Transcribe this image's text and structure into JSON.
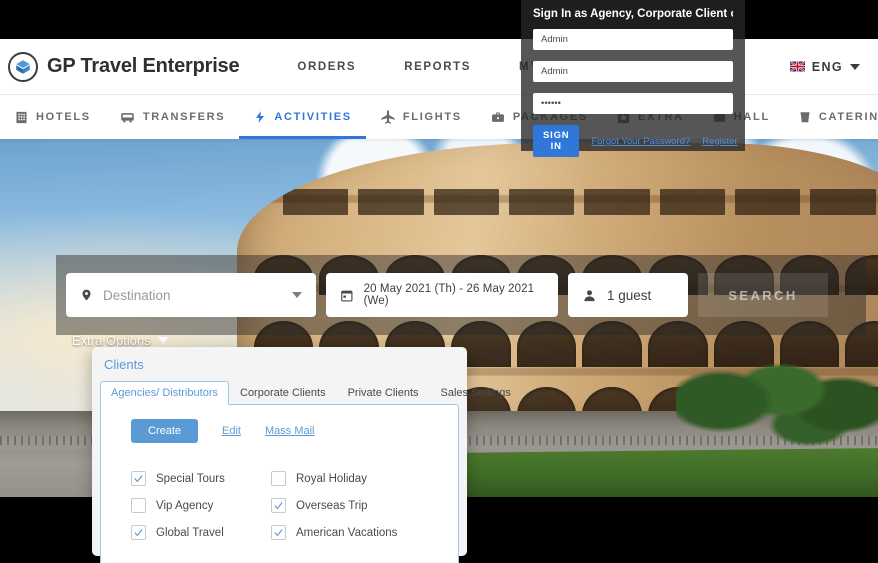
{
  "header": {
    "logo_text": "GP Travel Enterprise",
    "logo_icon": "cube-logo-icon",
    "nav": [
      {
        "label": "ORDERS",
        "name": "orders"
      },
      {
        "label": "REPORTS",
        "name": "reports"
      },
      {
        "label": "MY COMPANY",
        "name": "my-company"
      }
    ],
    "language": {
      "label": "ENG",
      "flag": "uk-flag-icon"
    }
  },
  "subnav": [
    {
      "label": "HOTELS",
      "icon": "building-icon",
      "active": false
    },
    {
      "label": "TRANSFERS",
      "icon": "bus-icon",
      "active": false
    },
    {
      "label": "ACTIVITIES",
      "icon": "bolt-icon",
      "active": true
    },
    {
      "label": "FLIGHTS",
      "icon": "plane-icon",
      "active": false
    },
    {
      "label": "PACKAGES",
      "icon": "briefcase-icon",
      "active": false
    },
    {
      "label": "EXTRA",
      "icon": "star-icon",
      "active": false
    },
    {
      "label": "HALL",
      "icon": "hall-icon",
      "active": false
    },
    {
      "label": "CATERING",
      "icon": "cup-icon",
      "active": false
    }
  ],
  "search": {
    "destination": {
      "placeholder": "Destination",
      "value": "",
      "icon": "location-pin-icon"
    },
    "dates": {
      "value": "20 May 2021 (Th)  -  26 May 2021 (We)",
      "icon": "calendar-icon"
    },
    "guests": {
      "value": "1 guest",
      "icon": "person-icon"
    },
    "search_button": "SEARCH",
    "extra_options": "Extra Options"
  },
  "clients": {
    "title": "Clients",
    "tabs": [
      {
        "label": "Agencies/ Distributors",
        "active": true
      },
      {
        "label": "Corporate Clients",
        "active": false
      },
      {
        "label": "Private Clients",
        "active": false
      },
      {
        "label": "Sales Settings",
        "active": false
      }
    ],
    "actions": {
      "create": "Create",
      "edit": "Edit",
      "mass_mail": "Mass Mail"
    },
    "checkboxes": [
      {
        "label": "Special Tours",
        "checked": true
      },
      {
        "label": "Royal Holiday",
        "checked": false
      },
      {
        "label": "Vip Agency",
        "checked": false
      },
      {
        "label": "Overseas Trip",
        "checked": true
      },
      {
        "label": "Global Travel",
        "checked": true
      },
      {
        "label": "American Vacations",
        "checked": true
      }
    ]
  },
  "signin": {
    "title": "Sign In as Agency, Corporate Client or Supplier",
    "fields": [
      {
        "name": "company",
        "value": "Admin"
      },
      {
        "name": "login",
        "value": "Admin"
      },
      {
        "name": "password",
        "value": "••••••"
      }
    ],
    "submit": "SIGN IN",
    "forgot": "Forgot Your Password?",
    "register": "Register"
  },
  "colors": {
    "accent_blue": "#2f77d8",
    "panel_blue": "#5b9bd5",
    "nav_gray": "#6b6b6b"
  }
}
